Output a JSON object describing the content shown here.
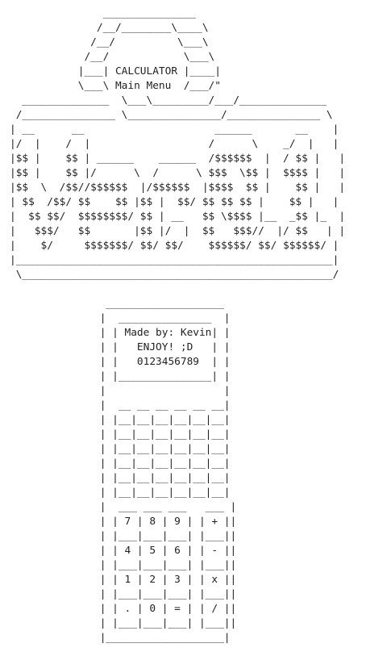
{
  "header": {
    "title_art": "               _______________\n              /__/________\\____\\\n             /__/          \\___\\\n            /__/            \\___\\\n           |___| CALCULATOR |____|\n           \\___\\ Main Menu  /___/\"\n  ______________  \\___\\_________/___/______________\n /_______________ \\_______________/_______________ \\\n| __      __                     ______       __    |\n|/  |    /  |                   /      \\    _/  |   |\n|$$ |    $$ | ______    ______  /$$$$$$  |  / $$ |   |\n|$$ |    $$ |/      \\  /      \\ $$$  \\$$ |  $$$$ |   |\n|$$  \\  /$$//$$$$$$  |/$$$$$$  |$$$$  $$ |    $$ |   |\n| $$  /$$/ $$    $$ |$$ |  $$/ $$ $$ $$ |    $$ |   |\n|  $$ $$/  $$$$$$$$/ $$ | __   $$ \\$$$$ |__  _$$ |_  |\n|   $$$/   $$       |$$ |/  |  $$   $$$//  |/ $$   | |\n|    $/     $$$$$$$/ $$/ $$/    $$$$$$/ $$/ $$$$$$/ |\n|___________________________________________________|\n \\__________________________________________________/"
  },
  "calculator": {
    "art": "  ___________________\n |  _______________  |\n | | Made by: Kevin| |\n | |   ENJOY! ;D   | |\n | |   0123456789  | |\n | |_______________| |\n |                   |\n |  __ __ __ __ __ __|\n | |__|__|__|__|__|__|\n | |__|__|__|__|__|__|\n | |__|__|__|__|__|__|\n | |__|__|__|__|__|__|\n | |__|__|__|__|__|__|\n | |__|__|__|__|__|__|\n |  ___ ___ ___   ___ |\n | | 7 | 8 | 9 | | + ||\n | |___|___|___| |___||\n | | 4 | 5 | 6 | | - ||\n | |___|___|___| |___||\n | | 1 | 2 | 3 | | x ||\n | |___|___|___| |___||\n | | . | 0 | = | | / ||\n | |___|___|___| |___||\n |___________________|"
  }
}
